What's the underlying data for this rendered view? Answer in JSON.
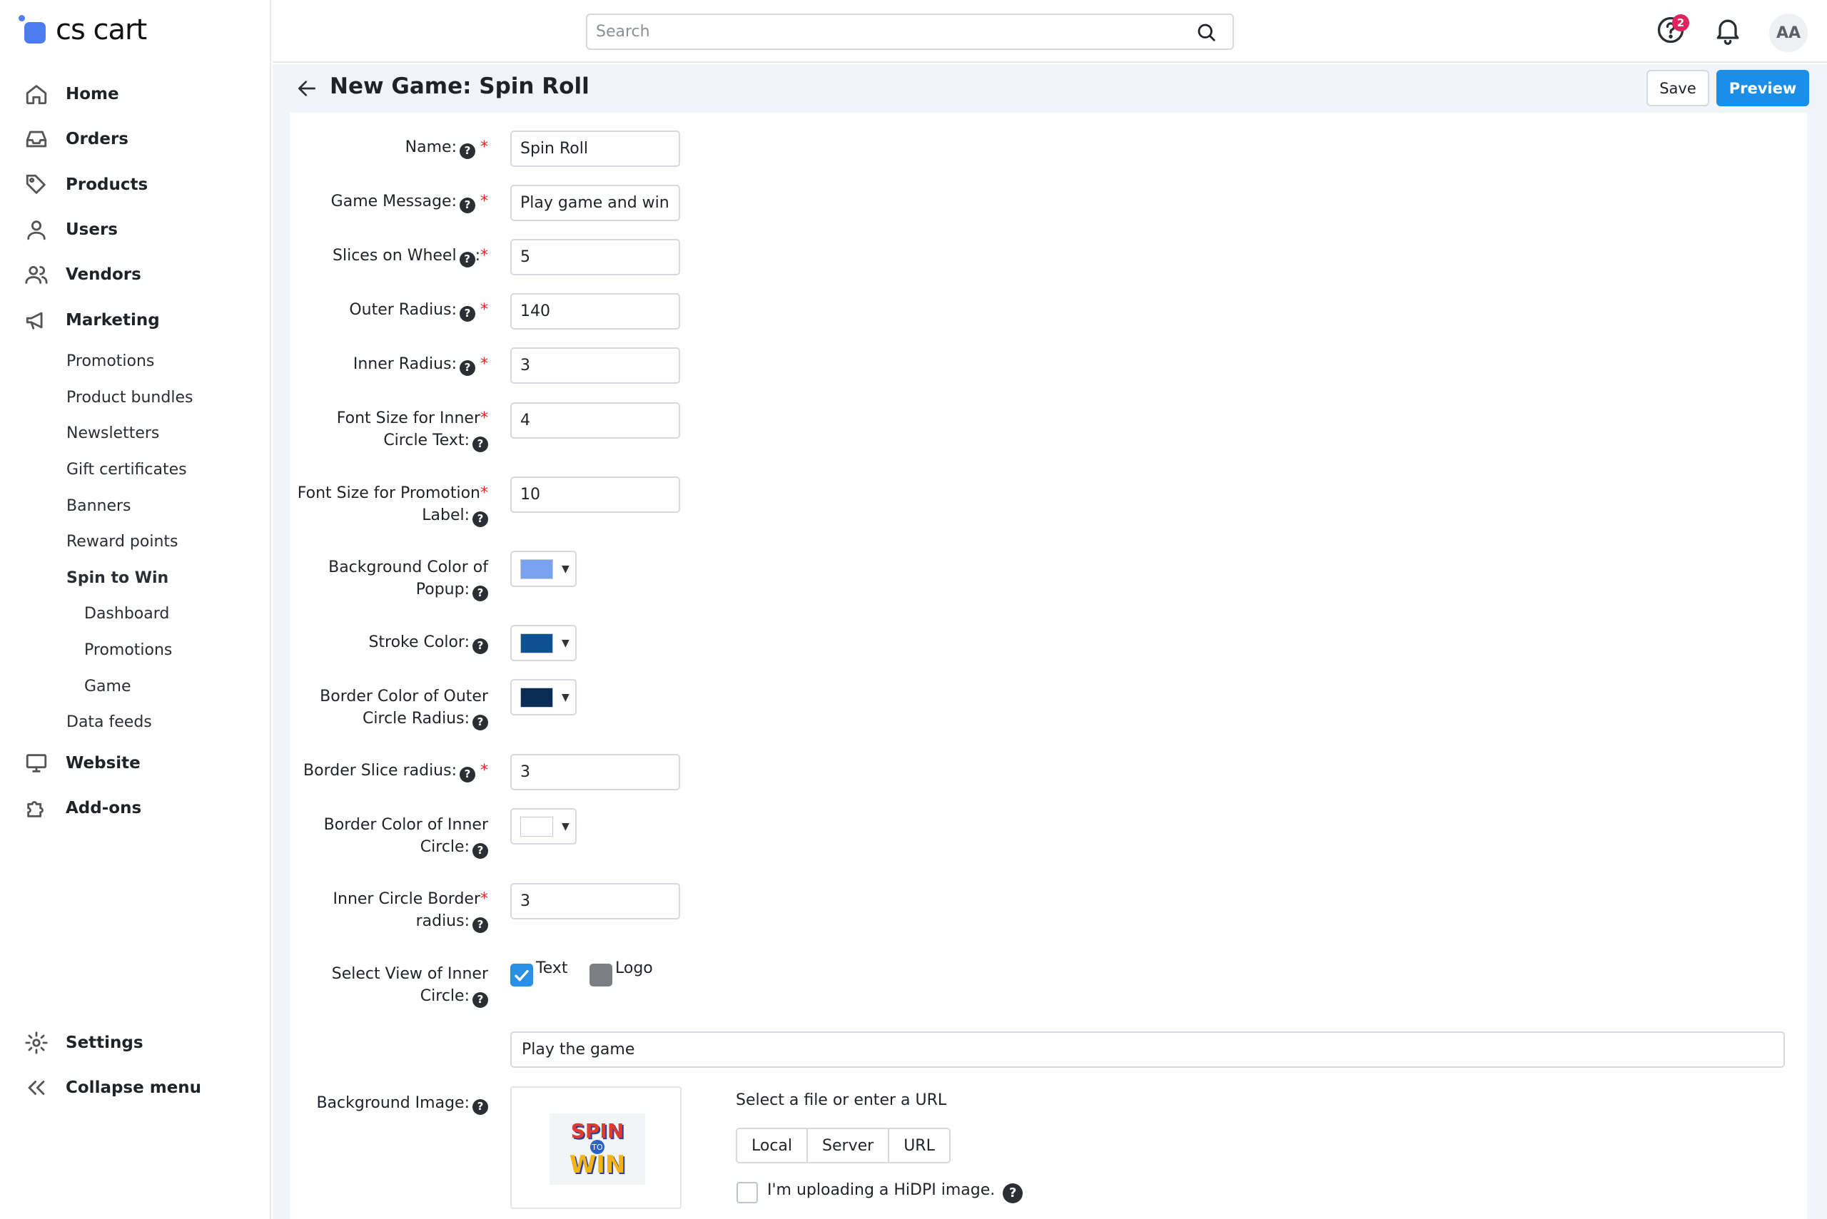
{
  "brand": {
    "name": "cs cart"
  },
  "sidebar": {
    "main_items": [
      {
        "label": "Home",
        "icon": "home-icon"
      },
      {
        "label": "Orders",
        "icon": "inbox-icon"
      },
      {
        "label": "Products",
        "icon": "tag-icon"
      },
      {
        "label": "Users",
        "icon": "user-icon"
      },
      {
        "label": "Vendors",
        "icon": "users-icon"
      },
      {
        "label": "Marketing",
        "icon": "megaphone-icon"
      }
    ],
    "marketing_sub": [
      "Promotions",
      "Product bundles",
      "Newsletters",
      "Gift certificates",
      "Banners",
      "Reward points",
      "Spin to Win"
    ],
    "spin_sub": [
      "Dashboard",
      "Promotions",
      "Game"
    ],
    "data_feeds": "Data feeds",
    "website": "Website",
    "addons": "Add-ons",
    "settings": "Settings",
    "collapse": "Collapse menu"
  },
  "topbar": {
    "search_placeholder": "Search",
    "help_badge_count": "2",
    "avatar_initials": "AA"
  },
  "header": {
    "title": "New Game: Spin Roll",
    "save_label": "Save",
    "preview_label": "Preview"
  },
  "form": {
    "name": {
      "label": "Name:",
      "value": "Spin Roll"
    },
    "game_message": {
      "label": "Game Message:",
      "value": "Play game and win"
    },
    "slices": {
      "label": "Slices on Wheel",
      "value": "5"
    },
    "outer_radius": {
      "label": "Outer Radius:",
      "value": "140"
    },
    "inner_radius": {
      "label": "Inner Radius:",
      "value": "3"
    },
    "font_inner": {
      "label_line1": "Font Size for Inner",
      "label_line2": "Circle Text:",
      "value": "4"
    },
    "font_promo": {
      "label_line1": "Font Size for Promotion",
      "label_line2": "Label:",
      "value": "10"
    },
    "bg_popup": {
      "label_line1": "Background Color of",
      "label_line2": "Popup:",
      "color": "#7aa3ef"
    },
    "stroke": {
      "label": "Stroke Color:",
      "color": "#0e5193"
    },
    "border_outer": {
      "label_line1": "Border Color of Outer",
      "label_line2": "Circle Radius:",
      "color": "#0a2d55"
    },
    "border_slice": {
      "label": "Border Slice radius:",
      "value": "3"
    },
    "border_inner": {
      "label_line1": "Border Color of Inner",
      "label_line2": "Circle:",
      "color": "#ffffff"
    },
    "inner_border_radius": {
      "label_line1": "Inner Circle Border",
      "label_line2": "radius:",
      "value": "3"
    },
    "select_view": {
      "label_line1": "Select View of Inner",
      "label_line2": "Circle:",
      "option_text": "Text",
      "option_logo": "Logo"
    },
    "inner_text_value": "Play the game",
    "bg_image": {
      "label": "Background Image:",
      "thumb_spin": "SPIN",
      "thumb_to": "TO",
      "thumb_win": "WIN",
      "caption": "Select a file or enter a URL",
      "sources": [
        "Local",
        "Server",
        "URL"
      ],
      "hidpi": "I'm uploading a HiDPI image."
    }
  },
  "colors": {
    "accent": "#1b8fe8",
    "required": "#e02a2a",
    "checkbox_checked": "#2a8fe6",
    "checkbox_gray": "#7b7f84"
  }
}
